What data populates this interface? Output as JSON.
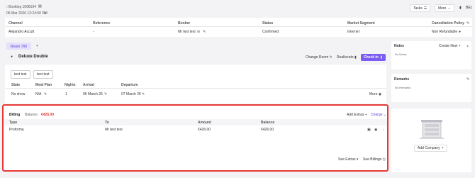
{
  "topbar": {
    "booking_link": "‹ Booking 1008194",
    "date": "06 Mar 2026 12:24:50 PM",
    "tasks": "Tasks",
    "more": "More",
    "right_label": "BEL"
  },
  "booking_table": {
    "headers": [
      "Channel",
      "Reference",
      "Booker",
      "Status",
      "Market Segment",
      "Cancellation Policy"
    ],
    "row": [
      "Alejandro Accutt",
      "-",
      "Mr test test",
      "Confirmed",
      "Internet",
      "Non Refundable"
    ]
  },
  "room_tabs": {
    "tab1": "Room 700",
    "add": "+"
  },
  "room": {
    "name": "Deluxe Double",
    "change_room": "Change Room",
    "reallocate": "Reallocate",
    "checkin": "Check in",
    "guests": [
      "test test",
      "test test"
    ],
    "headers": [
      "State",
      "Meal Plan",
      "Nights",
      "Arrival",
      "Departure"
    ],
    "row": [
      "No show",
      "N/A",
      "1",
      "06 March 26",
      "07 March 26"
    ],
    "more": "More"
  },
  "notes": {
    "title": "Notes",
    "create": "Create New",
    "empty": "No Notes"
  },
  "remarks": {
    "title": "Remarks",
    "empty": "No Remarks"
  },
  "company": {
    "add": "Add Company"
  },
  "billing": {
    "title": "Billing",
    "balance_label": "Balance",
    "balance_value": "€426.00",
    "add_extras": "Add Extras",
    "charge": "Charge",
    "headers": [
      "Type",
      "To",
      "Amount",
      "Balance"
    ],
    "row": [
      "Proforma",
      "Mr test test",
      "€426.00",
      "€426.00"
    ],
    "see_extras": "See Extras",
    "see_billings": "See Billings"
  },
  "colors": {
    "accent": "#7c5cf2",
    "danger": "#e53935"
  }
}
